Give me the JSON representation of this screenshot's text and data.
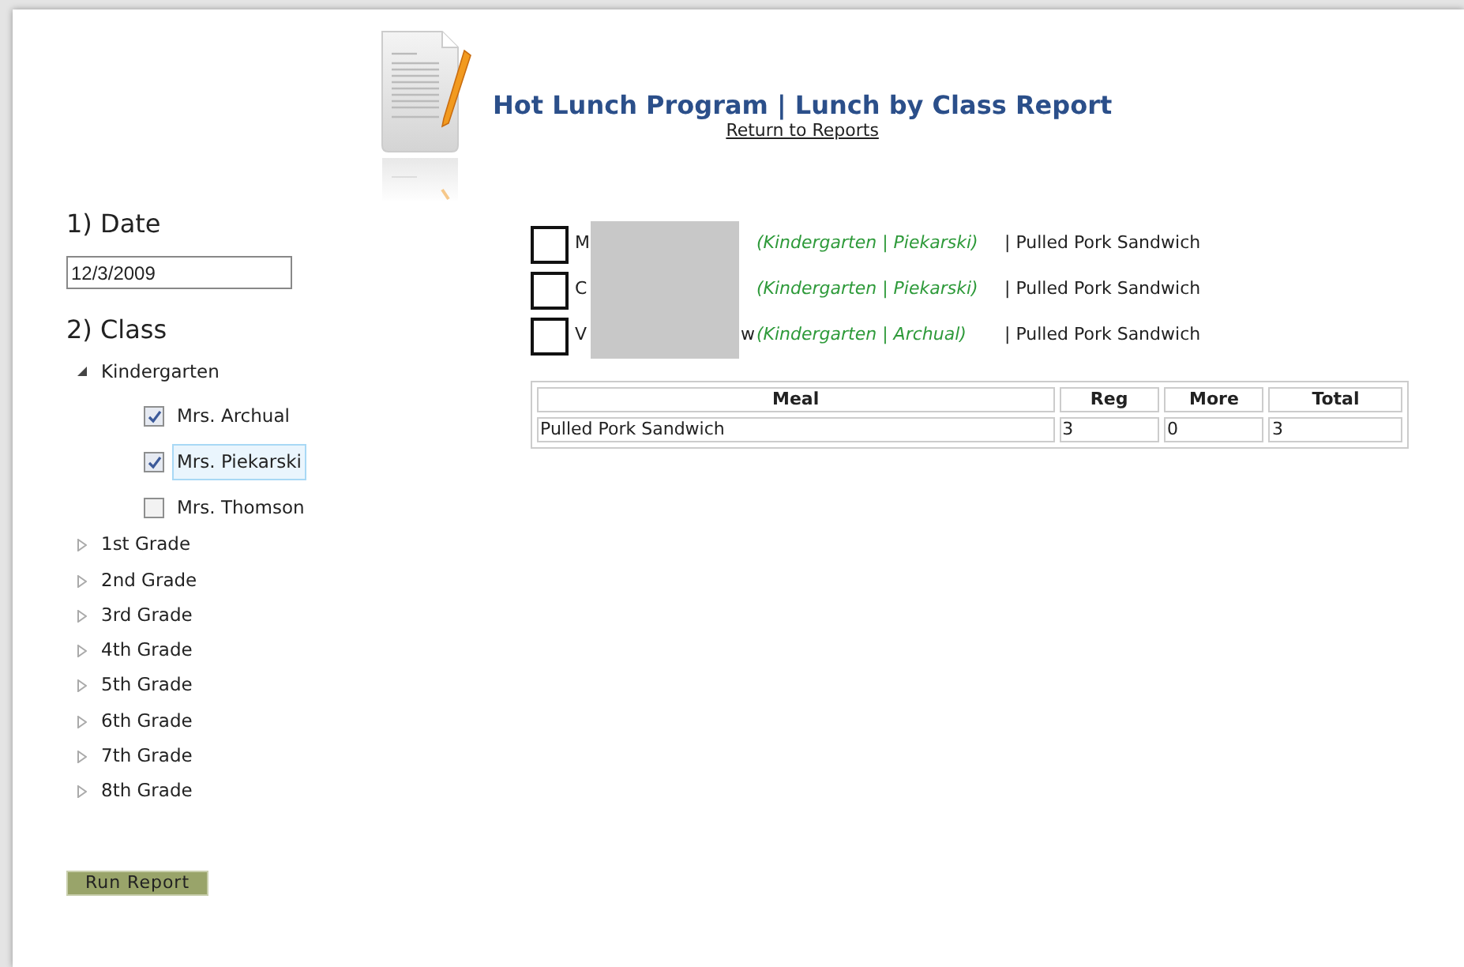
{
  "header": {
    "title": "Hot Lunch Program | Lunch by Class Report",
    "link": "Return to Reports"
  },
  "date": {
    "heading": "1) Date",
    "value": "12/3/2009"
  },
  "class": {
    "heading": "2) Class",
    "tree": [
      {
        "label": "Kindergarten",
        "expanded": true,
        "children": [
          {
            "label": "Mrs. Archual",
            "checked": true,
            "selected": false
          },
          {
            "label": "Mrs. Piekarski",
            "checked": true,
            "selected": true
          },
          {
            "label": "Mrs. Thomson",
            "checked": false,
            "selected": false
          }
        ]
      },
      {
        "label": "1st Grade",
        "expanded": false
      },
      {
        "label": "2nd Grade",
        "expanded": false
      },
      {
        "label": "3rd Grade",
        "expanded": false
      },
      {
        "label": "4th Grade",
        "expanded": false
      },
      {
        "label": "5th Grade",
        "expanded": false
      },
      {
        "label": "6th Grade",
        "expanded": false
      },
      {
        "label": "7th Grade",
        "expanded": false
      },
      {
        "label": "8th Grade",
        "expanded": false
      }
    ]
  },
  "run_button": "Run Report",
  "students": [
    {
      "checked": false,
      "name_start": "M",
      "class": "(Kindergarten | Piekarski)",
      "meal": "| Pulled Pork Sandwich"
    },
    {
      "checked": false,
      "name_start": "C",
      "class": "(Kindergarten | Piekarski)",
      "meal": "| Pulled Pork Sandwich"
    },
    {
      "checked": false,
      "name_start": "V",
      "name_end": "w",
      "class": "(Kindergarten | Archual)",
      "meal": "| Pulled Pork Sandwich"
    }
  ],
  "table": {
    "columns": [
      "Meal",
      "Reg",
      "More",
      "Total"
    ],
    "rows": [
      [
        "Pulled Pork Sandwich",
        "3",
        "0",
        "3"
      ]
    ]
  }
}
